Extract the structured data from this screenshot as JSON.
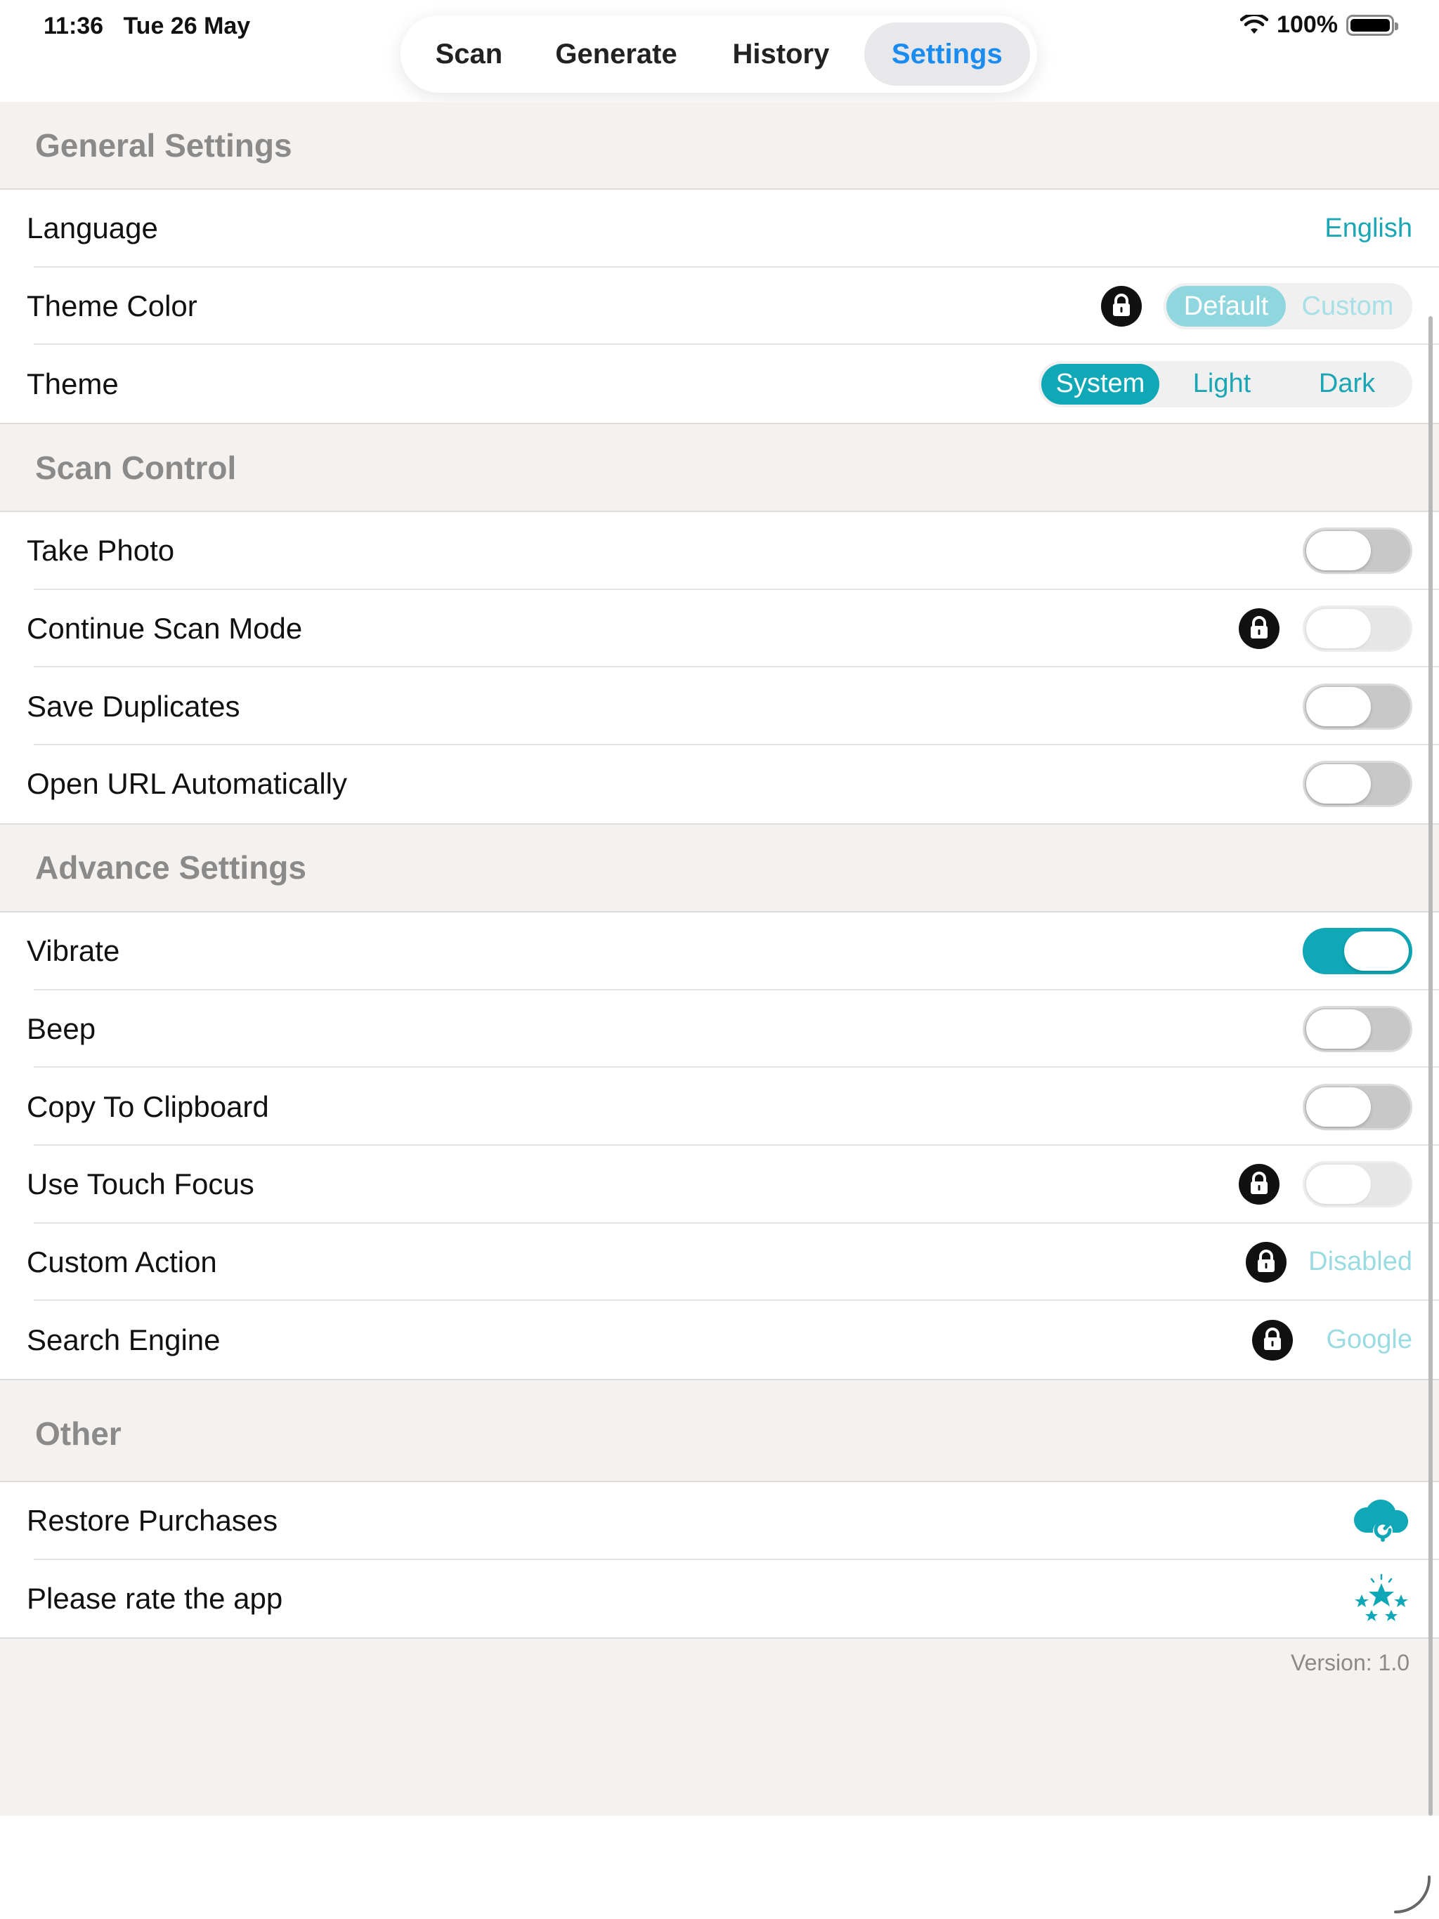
{
  "status_bar": {
    "time": "11:36",
    "date": "Tue 26 May",
    "battery": "100%",
    "icons": [
      "wifi-icon",
      "battery-icon"
    ]
  },
  "tabs": [
    {
      "label": "Scan",
      "active": false
    },
    {
      "label": "Generate",
      "active": false
    },
    {
      "label": "History",
      "active": false
    },
    {
      "label": "Settings",
      "active": true
    }
  ],
  "colors": {
    "accent": "#10a7b6",
    "tab_active_text": "#1a8cf0",
    "section_bg": "#f4f1ee",
    "section_header_text": "#8a8a8a"
  },
  "general": {
    "header": "General Settings",
    "language": {
      "label": "Language",
      "value": "English"
    },
    "theme_color": {
      "label": "Theme Color",
      "options": [
        "Default",
        "Custom"
      ],
      "selected": "Default",
      "locked": true
    },
    "theme": {
      "label": "Theme",
      "options": [
        "System",
        "Light",
        "Dark"
      ],
      "selected": "System"
    }
  },
  "scan_control": {
    "header": "Scan Control",
    "items": [
      {
        "label": "Take Photo",
        "on": false,
        "locked": false
      },
      {
        "label": "Continue Scan Mode",
        "on": false,
        "locked": true
      },
      {
        "label": "Save Duplicates",
        "on": false,
        "locked": false
      },
      {
        "label": "Open URL Automatically",
        "on": false,
        "locked": false
      }
    ]
  },
  "advance": {
    "header": "Advance Settings",
    "vibrate": {
      "label": "Vibrate",
      "on": true
    },
    "beep": {
      "label": "Beep",
      "on": false
    },
    "copy_clipboard": {
      "label": "Copy To Clipboard",
      "on": false
    },
    "touch_focus": {
      "label": "Use Touch Focus",
      "on": false,
      "locked": true
    },
    "custom_action": {
      "label": "Custom Action",
      "value": "Disabled",
      "locked": true
    },
    "search_engine": {
      "label": "Search Engine",
      "value": "Google",
      "locked": true
    }
  },
  "other": {
    "header": "Other",
    "restore": {
      "label": "Restore Purchases",
      "icon": "cloud-restore-icon"
    },
    "rate": {
      "label": "Please rate the app",
      "icon": "stars-icon"
    }
  },
  "version": "Version: 1.0"
}
